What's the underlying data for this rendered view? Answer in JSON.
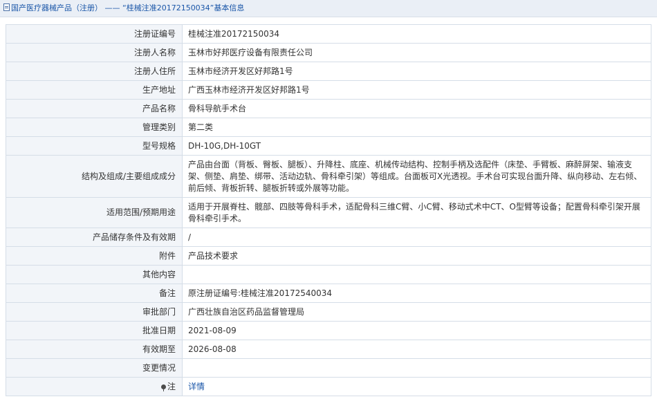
{
  "breadcrumb": {
    "root": "国产医疗器械产品（注册）",
    "separator": "——",
    "title": "“桂械注准20172150034”基本信息"
  },
  "rows": [
    {
      "label": "注册证编号",
      "value": "桂械注准20172150034"
    },
    {
      "label": "注册人名称",
      "value": "玉林市好邦医疗设备有限责任公司"
    },
    {
      "label": "注册人住所",
      "value": "玉林市经济开发区好邦路1号"
    },
    {
      "label": "生产地址",
      "value": "广西玉林市经济开发区好邦路1号"
    },
    {
      "label": "产品名称",
      "value": "骨科导航手术台"
    },
    {
      "label": "管理类别",
      "value": "第二类"
    },
    {
      "label": "型号规格",
      "value": "DH-10G,DH-10GT"
    },
    {
      "label": "结构及组成/主要组成成分",
      "value": "产品由台面（背板、臀板、腿板）、升降柱、底座、机械传动结构、控制手柄及选配件（床垫、手臂板、麻醉屏架、输液支架、侧垫、肩垫、绑带、活动边轨、骨科牵引架）等组成。台面板可X光透视。手术台可实现台面升降、纵向移动、左右倾、前后倾、背板折转、腿板折转或外展等功能。"
    },
    {
      "label": "适用范围/预期用途",
      "value": "适用于开展脊柱、髋部、四肢等骨科手术，适配骨科三维C臂、小C臂、移动式术中CT、O型臂等设备；配置骨科牵引架开展骨科牵引手术。"
    },
    {
      "label": "产品储存条件及有效期",
      "value": "/"
    },
    {
      "label": "附件",
      "value": "产品技术要求"
    },
    {
      "label": "其他内容",
      "value": ""
    },
    {
      "label": "备注",
      "value": "原注册证编号:桂械注准20172540034"
    },
    {
      "label": "审批部门",
      "value": "广西壮族自治区药品监督管理局"
    },
    {
      "label": "批准日期",
      "value": "2021-08-09"
    },
    {
      "label": "有效期至",
      "value": "2026-08-08"
    },
    {
      "label": "变更情况",
      "value": ""
    },
    {
      "label": "注",
      "value": "详情"
    }
  ],
  "colors": {
    "link": "#1a56a8",
    "label_bg": "#f2f5f9",
    "border": "#d5dde7",
    "header_bg": "#eaeff6"
  }
}
